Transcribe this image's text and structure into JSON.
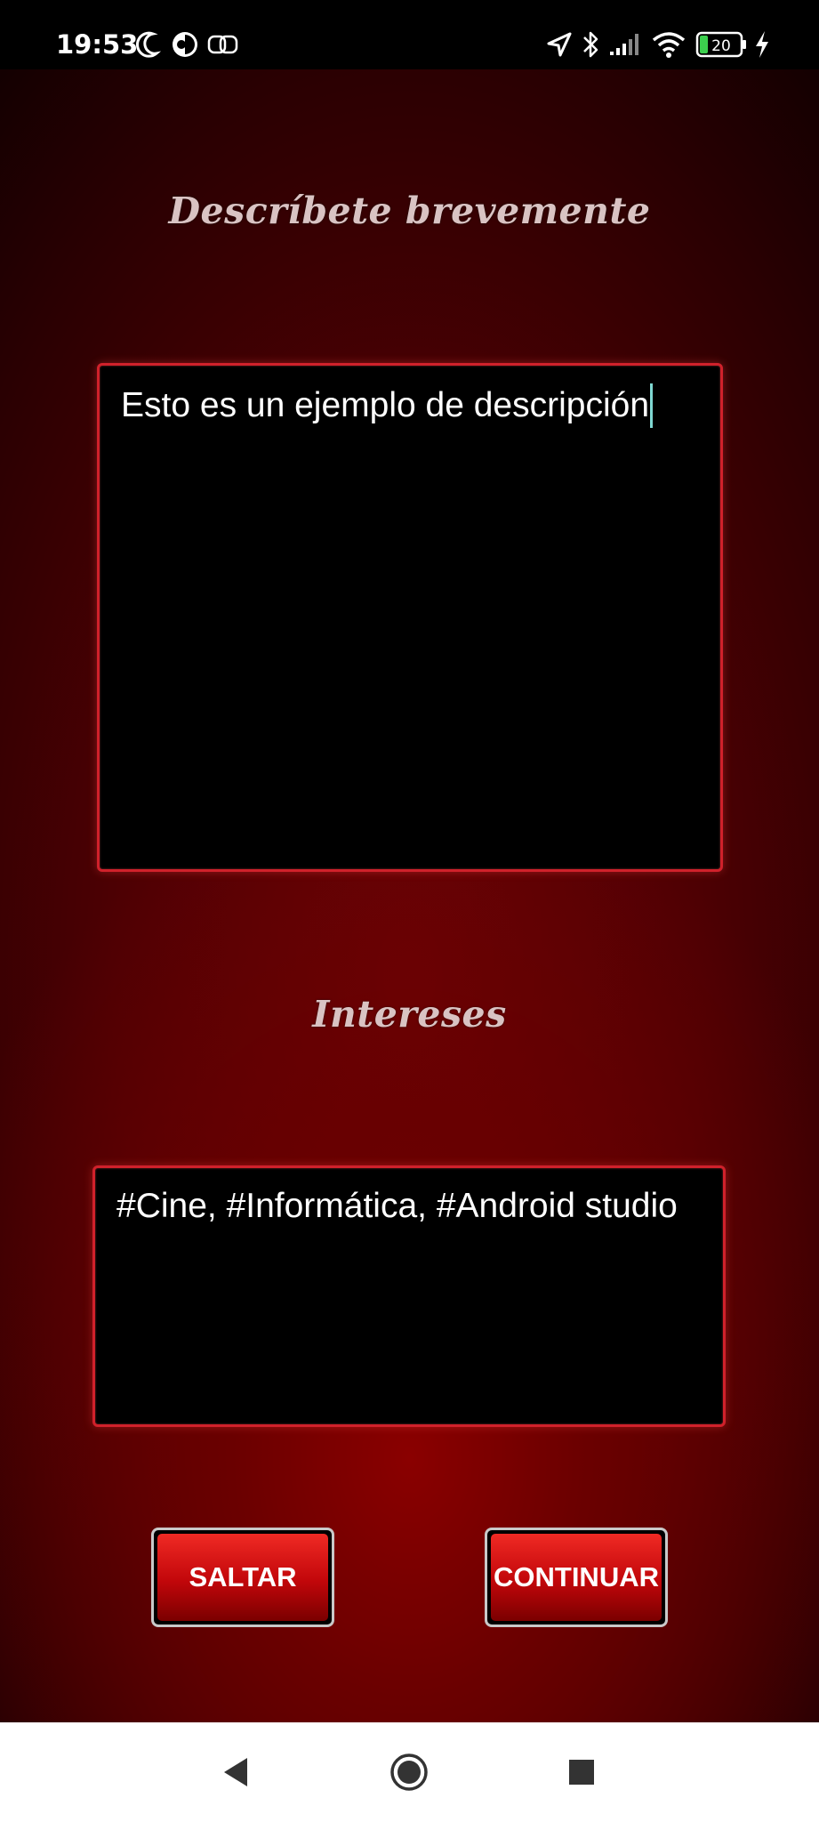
{
  "status_bar": {
    "time": "19:53",
    "battery_level": "20",
    "icons": [
      "moon-icon",
      "data-saver-icon",
      "link-icon",
      "location-icon",
      "bluetooth-icon",
      "signal-icon",
      "wifi-icon",
      "battery-icon",
      "charging-icon"
    ]
  },
  "description_section": {
    "title": "Descríbete brevemente",
    "value": "Esto es un ejemplo de descripción"
  },
  "interests_section": {
    "title": "Intereses",
    "value": "#Cine, #Informática, #Android studio"
  },
  "buttons": {
    "skip_label": "SALTAR",
    "continue_label": "CONTINUAR"
  },
  "nav_bar": {
    "icons": [
      "back-icon",
      "home-icon",
      "recents-icon"
    ]
  },
  "colors": {
    "accent_border": "#d0212b",
    "button_red": "#c1060a",
    "background_dark_red": "#4d0003",
    "heading_text": "#d9c3c3"
  }
}
